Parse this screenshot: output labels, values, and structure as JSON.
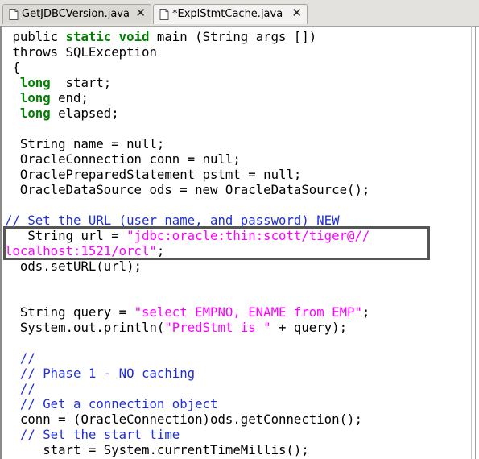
{
  "tabs": [
    {
      "label": "GetJDBCVersion.java",
      "close": "✕",
      "icon": "java-file-icon"
    },
    {
      "label": "*ExplStmtCache.java",
      "close": "✕",
      "icon": "java-file-icon"
    }
  ],
  "code": {
    "l1": {
      "a": " public ",
      "b": "static void",
      "c": " main (String args [])"
    },
    "l2": " throws SQLException",
    "l3": " {",
    "l4": {
      "a": "  ",
      "b": "long",
      "c": "  start;"
    },
    "l5": {
      "a": "  ",
      "b": "long",
      "c": " end;"
    },
    "l6": {
      "a": "  ",
      "b": "long",
      "c": " elapsed;"
    },
    "l7": "",
    "l8": "  String name = null;",
    "l9": "  OracleConnection conn = null;",
    "l10": "  OraclePreparedStatement pstmt = null;",
    "l11": "  OracleDataSource ods = new OracleDataSource();",
    "l12": "",
    "l13": "// Set the URL (user name, and password) NEW",
    "l14": {
      "a": "   String url = ",
      "b": "\"jdbc:oracle:thin:scott/tiger@//"
    },
    "l15": {
      "a": "localhost:1521/orcl\"",
      "b": ";"
    },
    "l16": "  ods.setURL(url);",
    "l17": "",
    "l18": "",
    "l19": {
      "a": "  String query = ",
      "b": "\"select EMPNO, ENAME from EMP\"",
      "c": ";"
    },
    "l20": {
      "a": "  System.out.println(",
      "b": "\"PredStmt is \"",
      "c": " + query);"
    },
    "l21": "",
    "l22": "  //",
    "l23": "  // Phase 1 - NO caching",
    "l24": "  //",
    "l25": "  // Get a connection object",
    "l26": "  conn = (OracleConnection)ods.getConnection();",
    "l27": "  // Set the start time",
    "l28": "     start = System.currentTimeMillis();"
  },
  "colors": {
    "keyword": "#008000",
    "string": "#ff00ff",
    "comment": "#1f2fd8",
    "highlight_border": "#555555"
  }
}
